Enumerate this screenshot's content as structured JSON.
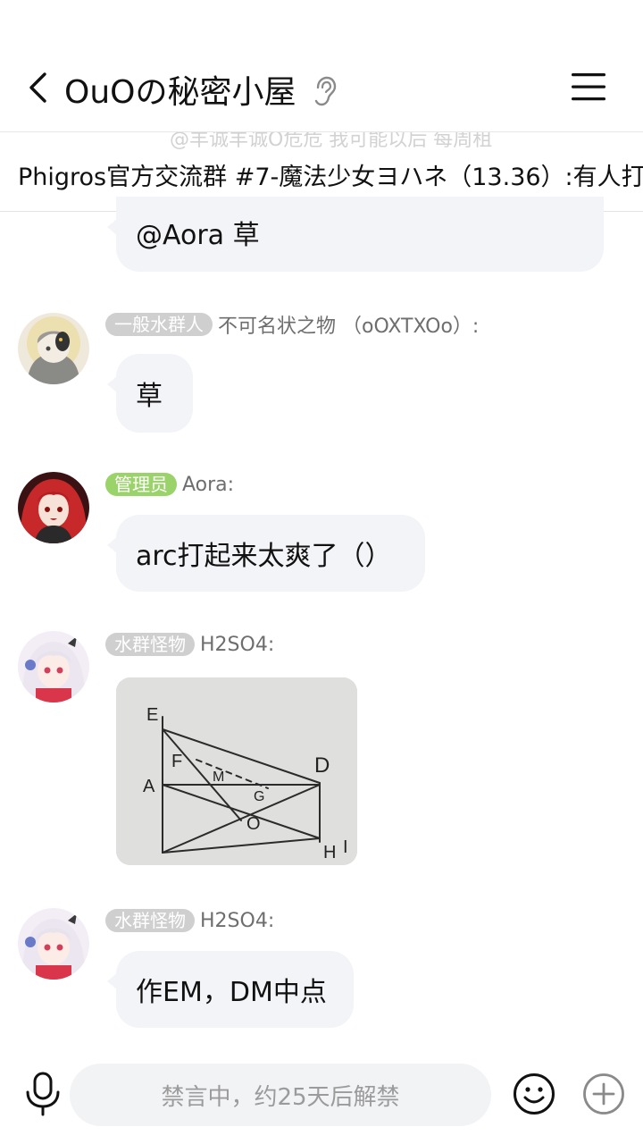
{
  "header": {
    "title": "OuOの秘密小屋",
    "back_icon": "chevron-left-icon",
    "ear_icon": "ear-icon",
    "menu_icon": "hamburger-menu-icon"
  },
  "banner": {
    "ghost_text": "@羊诚羊诚O危危 我可能以后 每周租",
    "text": "Phigros官方交流群 #7-魔法少女ヨハネ（13.36）:有人打"
  },
  "messages": [
    {
      "bubble": "@Aora 草"
    },
    {
      "badge": "一般水群人",
      "sender": "不可名状之物 （oOXTXOo）:",
      "bubble": "草"
    },
    {
      "badge": "管理员",
      "sender": "Aora:",
      "bubble": "arc打起来太爽了（）"
    },
    {
      "badge": "水群怪物",
      "sender": "H2SO4:",
      "image": "geometry-sketch-photo",
      "sketch_labels": {
        "e": "E",
        "f": "F",
        "m": "M",
        "a": "A",
        "g": "G",
        "o": "O",
        "d": "D",
        "h": "H",
        "i": "I"
      }
    },
    {
      "badge": "水群怪物",
      "sender": "H2SO4:",
      "bubble": "作EM，DM中点"
    }
  ],
  "input": {
    "placeholder": "禁言中，约25天后解禁",
    "mic_icon": "microphone-icon",
    "emoji_icon": "smiley-icon",
    "plus_icon": "plus-circle-icon"
  },
  "colors": {
    "bubble_bg": "#f3f4f8",
    "badge_gray": "#cfcfcf",
    "badge_green": "#9bd36b",
    "input_bg": "#f2f3f5"
  }
}
